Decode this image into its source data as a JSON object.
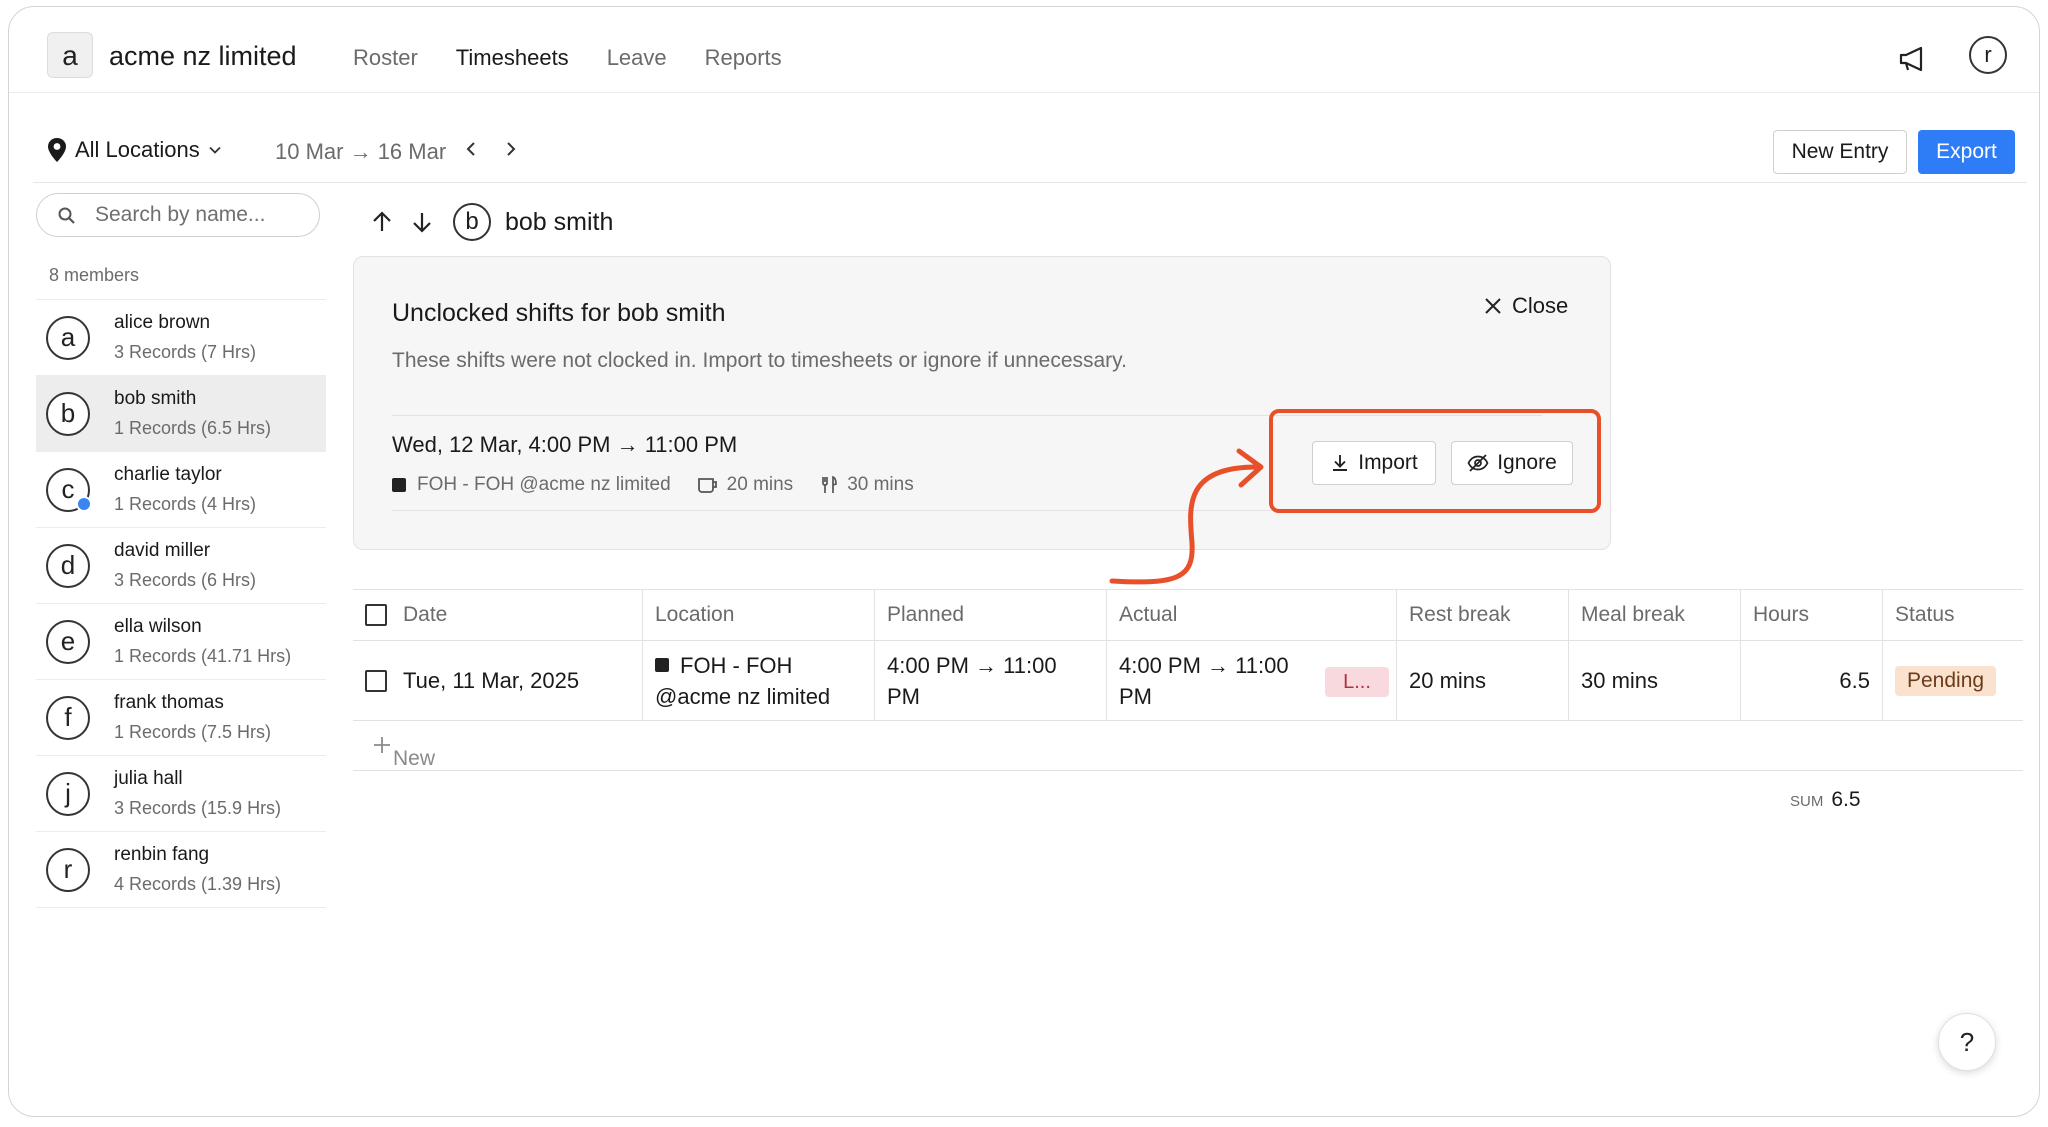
{
  "org": {
    "avatar_letter": "a",
    "name": "acme nz limited"
  },
  "nav": {
    "items": [
      "Roster",
      "Timesheets",
      "Leave",
      "Reports"
    ],
    "active": "Timesheets"
  },
  "user": {
    "avatar_letter": "r"
  },
  "toolbar": {
    "location_label": "All Locations",
    "date_range": "10 Mar → 16 Mar",
    "new_entry_label": "New Entry",
    "export_label": "Export",
    "accent_color": "#2f7df6"
  },
  "sidebar": {
    "search_placeholder": "Search by name...",
    "members_count": "8 members",
    "members": [
      {
        "letter": "a",
        "name": "alice brown",
        "records": "3 Records (7 Hrs)"
      },
      {
        "letter": "b",
        "name": "bob smith",
        "records": "1 Records (6.5 Hrs)",
        "selected": true
      },
      {
        "letter": "c",
        "name": "charlie taylor",
        "records": "1 Records (4 Hrs)",
        "badge": "verified"
      },
      {
        "letter": "d",
        "name": "david miller",
        "records": "3 Records (6 Hrs)"
      },
      {
        "letter": "e",
        "name": "ella wilson",
        "records": "1 Records (41.71 Hrs)"
      },
      {
        "letter": "f",
        "name": "frank thomas",
        "records": "1 Records (7.5 Hrs)"
      },
      {
        "letter": "j",
        "name": "julia hall",
        "records": "3 Records (15.9 Hrs)"
      },
      {
        "letter": "r",
        "name": "renbin fang",
        "records": "4 Records (1.39 Hrs)"
      }
    ]
  },
  "main": {
    "person_letter": "b",
    "person_name": "bob smith",
    "unclocked": {
      "title": "Unclocked shifts for bob smith",
      "description": "These shifts were not clocked in. Import to timesheets or ignore if unnecessary.",
      "close_label": "Close",
      "shift_time": "Wed, 12 Mar, 4:00 PM → 11:00 PM",
      "location": "FOH - FOH @acme nz limited",
      "rest_break": "20 mins",
      "meal_break": "30 mins",
      "import_label": "Import",
      "ignore_label": "Ignore",
      "highlight_color": "#e8502a"
    },
    "table": {
      "headers": [
        "Date",
        "Location",
        "Planned",
        "Actual",
        "Rest break",
        "Meal break",
        "Hours",
        "Status"
      ],
      "rows": [
        {
          "date": "Tue, 11 Mar, 2025",
          "location_line1": "FOH - FOH",
          "location_line2": "@acme nz limited",
          "planned_line1": "4:00 PM → 11:00",
          "planned_line2": "PM",
          "actual_line1": "4:00 PM → 11:00",
          "actual_line2": "PM",
          "actual_badge": "L...",
          "rest_break": "20 mins",
          "meal_break": "30 mins",
          "hours": "6.5",
          "status": "Pending"
        }
      ],
      "new_label": "New",
      "sum_label": "SUM",
      "sum_value": "6.5"
    }
  },
  "help_label": "?"
}
